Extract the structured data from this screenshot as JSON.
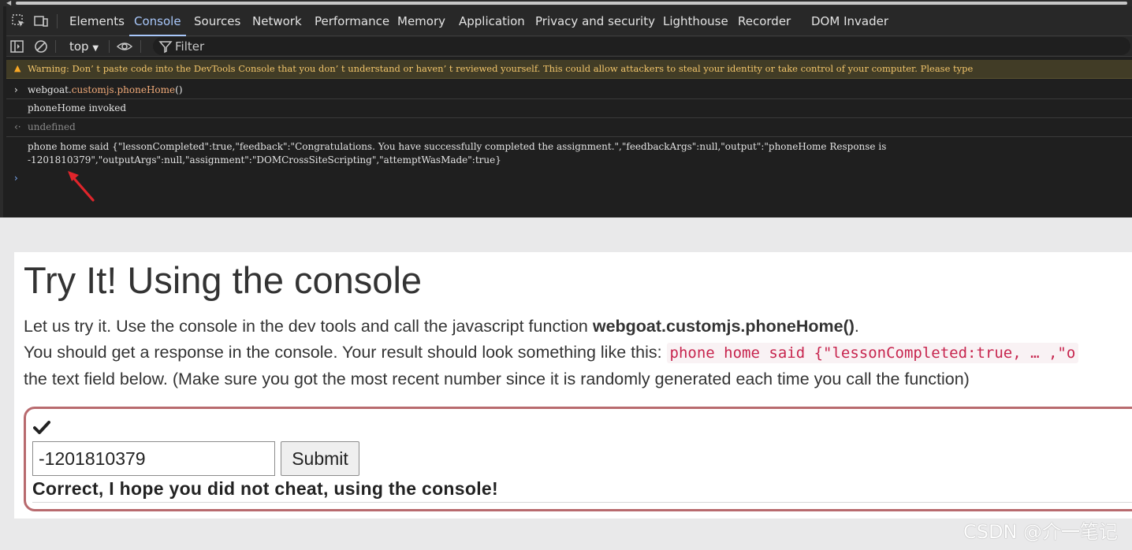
{
  "devtools": {
    "tabs": [
      "Elements",
      "Console",
      "Sources",
      "Network",
      "Performance",
      "Memory",
      "Application",
      "Privacy and security",
      "Lighthouse",
      "Recorder",
      "DOM Invader"
    ],
    "active_tab": "Console",
    "context_label": "top",
    "filter_label": "Filter",
    "icons": [
      "inspect-element-icon",
      "device-toolbar-icon",
      "sidebar-toggle-icon",
      "clear-console-icon",
      "eye-icon",
      "filter-icon"
    ]
  },
  "console": {
    "warning": "Warning: Don’ t paste code into the DevTools Console that you don’ t understand or haven’ t reviewed yourself. This could allow attackers to steal your identity or take control of your computer. Please type",
    "command": {
      "object": "webgoat.",
      "prop": "customjs.",
      "fn": "phoneHome",
      "parens": "()"
    },
    "log_line": "phoneHome invoked",
    "return_value": "undefined",
    "response": "phone home said {\"lessonCompleted\":true,\"feedback\":\"Congratulations. You have successfully completed the assignment.\",\"feedbackArgs\":null,\"output\":\"phoneHome Response is -1201810379\",\"outputArgs\":null,\"assignment\":\"DOMCrossSiteScripting\",\"attemptWasMade\":true}",
    "prompt_glyph": "›"
  },
  "lesson": {
    "title": "Try It! Using the console",
    "line1_prefix": "Let us try it. Use the console in the dev tools and call the javascript function ",
    "line1_bold": "webgoat.customjs.phoneHome()",
    "line1_suffix": ".",
    "line2_prefix": "You should get a response in the console. Your result should look something like this: ",
    "line2_code": "phone home said {\"lessonCompleted:true, … ,\"o",
    "line3": "the text field below. (Make sure you got the most recent number since it is randomly generated each time you call the function)",
    "answer_value": "-1201810379",
    "submit_label": "Submit",
    "feedback": "Correct, I hope you did not cheat, using the console!"
  },
  "watermark": "CSDN @介一笔记"
}
